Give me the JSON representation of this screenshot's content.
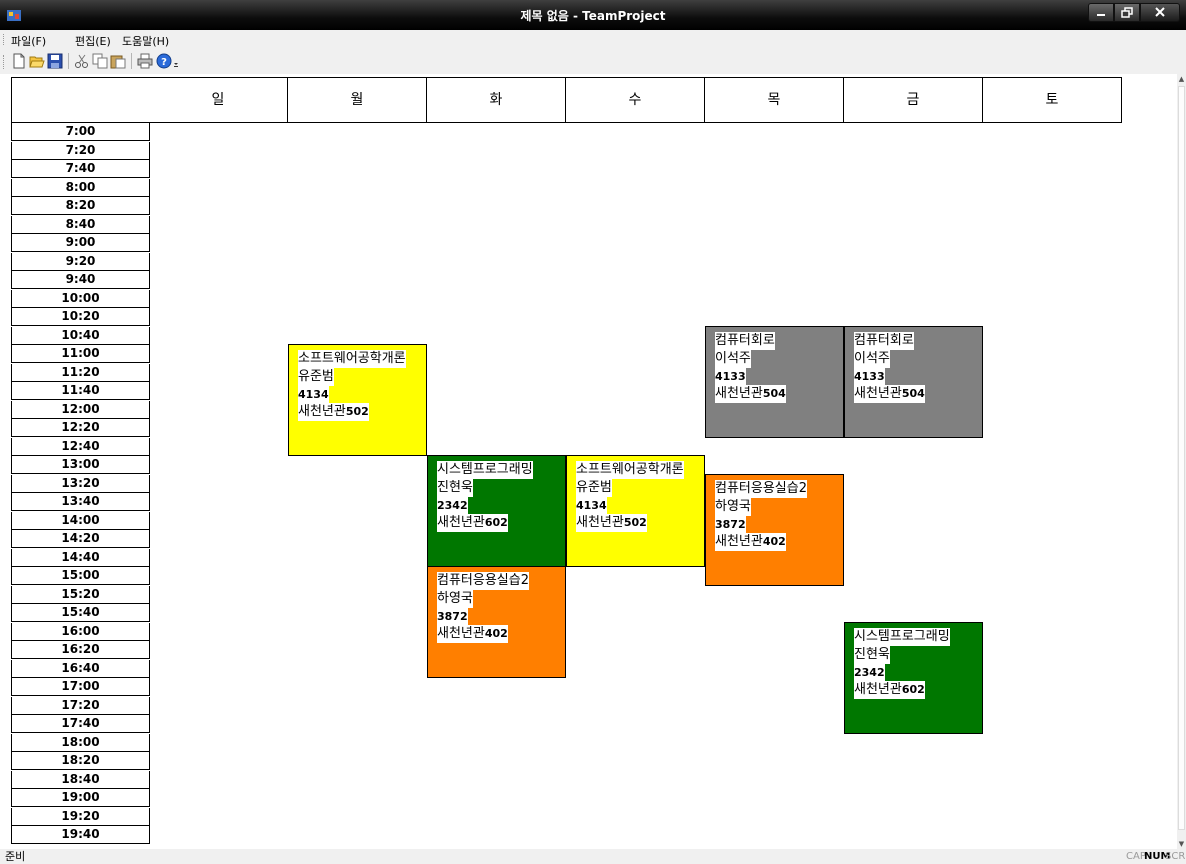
{
  "window": {
    "title": "제목 없음 - TeamProject"
  },
  "menu": {
    "items": [
      "파일(F)",
      "편집(E)",
      "도움말(H)"
    ]
  },
  "toolbar": {
    "buttons": [
      "new-file-icon",
      "open-folder-icon",
      "save-icon",
      "cut-icon",
      "copy-icon",
      "paste-icon",
      "print-icon",
      "help-icon",
      "toolbar-overflow-icon"
    ]
  },
  "schedule": {
    "days": [
      "일",
      "월",
      "화",
      "수",
      "목",
      "금",
      "토"
    ],
    "times": [
      "7:00",
      "7:20",
      "7:40",
      "8:00",
      "8:20",
      "8:40",
      "9:00",
      "9:20",
      "9:40",
      "10:00",
      "10:20",
      "10:40",
      "11:00",
      "11:20",
      "11:40",
      "12:00",
      "12:20",
      "12:40",
      "13:00",
      "13:20",
      "13:40",
      "14:00",
      "14:20",
      "14:40",
      "15:00",
      "15:20",
      "15:40",
      "16:00",
      "16:20",
      "16:40",
      "17:00",
      "17:20",
      "17:40",
      "18:00",
      "18:20",
      "18:40",
      "19:00",
      "19:20",
      "19:40"
    ],
    "courses": [
      {
        "name": "소프트웨어공학개론",
        "professor": "유준범",
        "code": "4134",
        "building": "새천년관",
        "room": "502",
        "day": "월",
        "start": "11:00",
        "end": "13:00",
        "color": "#ffff00"
      },
      {
        "name": "컴퓨터회로",
        "professor": "이석주",
        "code": "4133",
        "building": "새천년관",
        "room": "504",
        "day": "목",
        "start": "10:40",
        "end": "12:40",
        "color": "#808080"
      },
      {
        "name": "컴퓨터회로",
        "professor": "이석주",
        "code": "4133",
        "building": "새천년관",
        "room": "504",
        "day": "금",
        "start": "10:40",
        "end": "12:40",
        "color": "#808080"
      },
      {
        "name": "시스템프로그래밍",
        "professor": "진현욱",
        "code": "2342",
        "building": "새천년관",
        "room": "602",
        "day": "화",
        "start": "13:00",
        "end": "15:00",
        "color": "#007700"
      },
      {
        "name": "소프트웨어공학개론",
        "professor": "유준범",
        "code": "4134",
        "building": "새천년관",
        "room": "502",
        "day": "수",
        "start": "13:00",
        "end": "15:00",
        "color": "#ffff00"
      },
      {
        "name": "컴퓨터응용실습2",
        "professor": "하영국",
        "code": "3872",
        "building": "새천년관",
        "room": "402",
        "day": "목",
        "start": "13:20",
        "end": "15:20",
        "color": "#ff7f00"
      },
      {
        "name": "컴퓨터응용실습2",
        "professor": "하영국",
        "code": "3872",
        "building": "새천년관",
        "room": "402",
        "day": "화",
        "start": "15:00",
        "end": "17:00",
        "color": "#ff7f00"
      },
      {
        "name": "시스템프로그래밍",
        "professor": "진현욱",
        "code": "2342",
        "building": "새천년관",
        "room": "602",
        "day": "금",
        "start": "16:00",
        "end": "18:00",
        "color": "#007700"
      }
    ]
  },
  "statusbar": {
    "text": "준비",
    "indicators": [
      {
        "label": "CAP",
        "active": false
      },
      {
        "label": "NUM",
        "active": true
      },
      {
        "label": "SCRL",
        "active": false
      }
    ]
  }
}
